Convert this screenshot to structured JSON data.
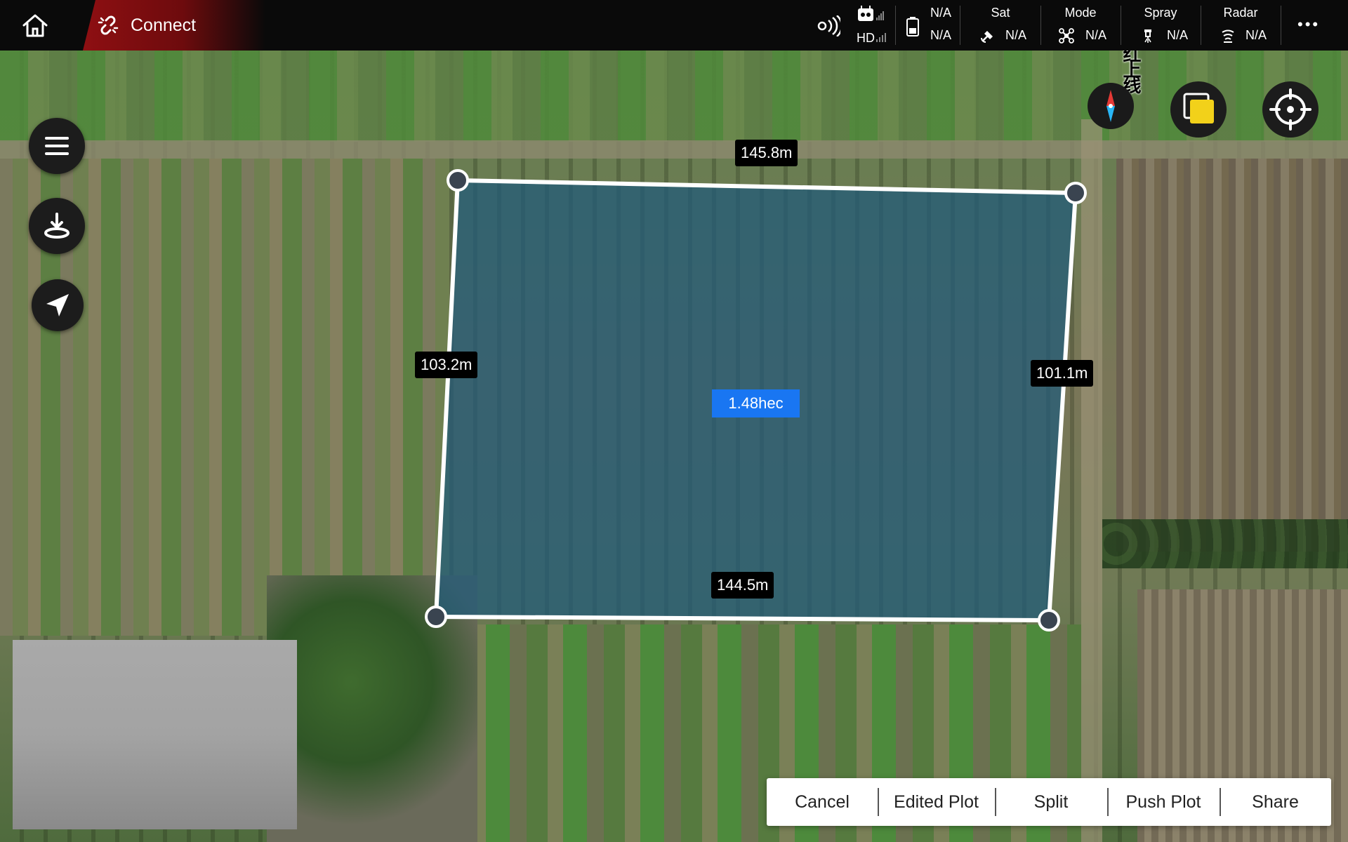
{
  "topbar": {
    "connect_label": "Connect",
    "hd_label": "HD",
    "battery_top_value": "N/A",
    "battery_bottom_value": "N/A",
    "sat": {
      "label": "Sat",
      "value": "N/A"
    },
    "mode": {
      "label": "Mode",
      "value": "N/A"
    },
    "spray": {
      "label": "Spray",
      "value": "N/A"
    },
    "radar": {
      "label": "Radar",
      "value": "N/A"
    },
    "more_label": "•••"
  },
  "map": {
    "overlay_text": "红上线",
    "plot": {
      "top_edge": "145.8m",
      "left_edge": "103.2m",
      "right_edge": "101.1m",
      "bottom_edge": "144.5m",
      "area": "1.48hec"
    }
  },
  "actions": {
    "cancel": "Cancel",
    "edited_plot": "Edited Plot",
    "split": "Split",
    "push_plot": "Push Plot",
    "share": "Share"
  },
  "colors": {
    "accent_red": "#8e0f12",
    "area_badge_blue": "#1976f2",
    "plot_fill": "#1f5a7a",
    "compass_red": "#e53935",
    "compass_blue": "#29b6f6",
    "layers_yellow": "#f2d11a"
  }
}
